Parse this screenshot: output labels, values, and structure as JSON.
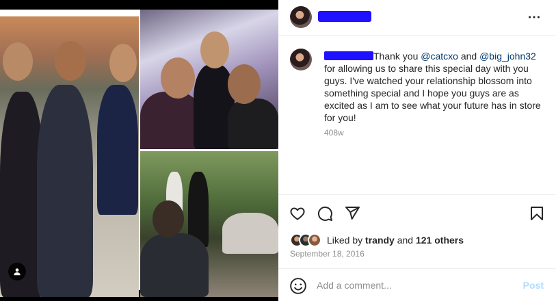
{
  "header": {
    "more_icon": "more-horizontal-icon"
  },
  "caption": {
    "text_1": "Thank you ",
    "mention_1": "@catcxo",
    "text_2": " and ",
    "mention_2": "@big_john32",
    "text_3": " for allowing us to share this special day with you guys. I've watched your relationship blossom into something special and I hope you guys are as excited as I am to see what your future has in store for you!",
    "time": "408w"
  },
  "actions": {
    "like_icon": "heart-icon",
    "comment_icon": "comment-icon",
    "share_icon": "share-icon",
    "save_icon": "bookmark-icon"
  },
  "likes": {
    "prefix": "Liked by ",
    "user": "trandy",
    "middle": " and ",
    "others": "121 others"
  },
  "date": "September 18, 2016",
  "comment": {
    "placeholder": "Add a comment...",
    "post_label": "Post",
    "emoji_icon": "emoji-icon"
  },
  "colors": {
    "redaction": "#1f10ff",
    "mention": "#00376b",
    "post_disabled": "#b3dbff"
  }
}
